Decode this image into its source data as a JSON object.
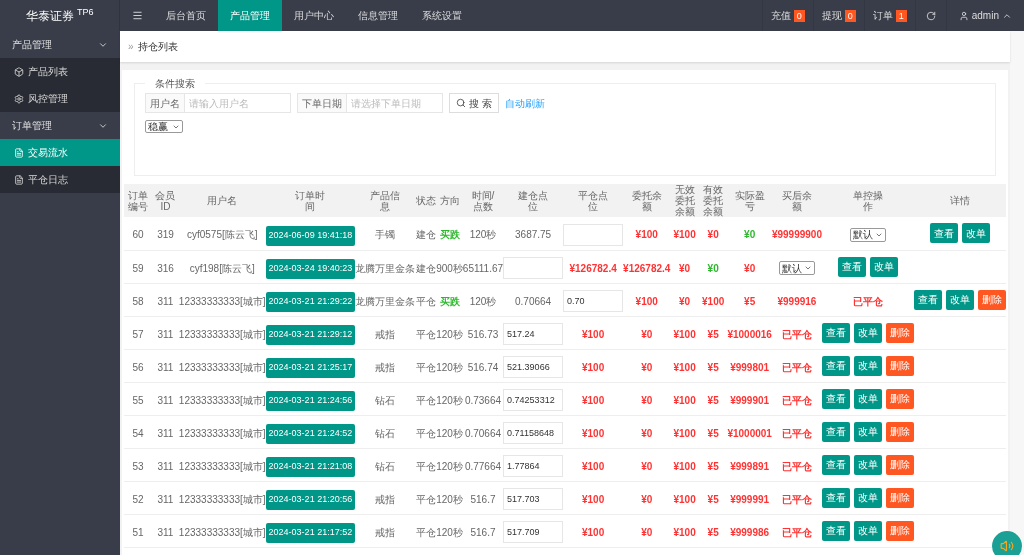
{
  "logo": {
    "text": "华泰证券 $^{TP6}$"
  },
  "top_nav": {
    "tabs": [
      {
        "label": "后台首页",
        "selected": false
      },
      {
        "label": "产品管理",
        "selected": true
      },
      {
        "label": "用户中心",
        "selected": false
      },
      {
        "label": "信息管理",
        "selected": false
      },
      {
        "label": "系统设置",
        "selected": false
      }
    ],
    "counters": [
      {
        "label": "充值",
        "count": "0"
      },
      {
        "label": "提现",
        "count": "0"
      },
      {
        "label": "订单",
        "count": "1"
      }
    ],
    "user": "admin"
  },
  "sidebar": {
    "groups": [
      {
        "label": "产品管理",
        "expanded": true,
        "items": [
          {
            "label": "产品列表",
            "kind": "cube",
            "selected": false
          },
          {
            "label": "风控管理",
            "kind": "gear",
            "selected": false
          }
        ]
      },
      {
        "label": "订单管理",
        "expanded": true,
        "items": [
          {
            "label": "交易流水",
            "kind": "doc",
            "selected": true
          },
          {
            "label": "平仓日志",
            "kind": "doc",
            "selected": false
          }
        ]
      }
    ]
  },
  "breadcrumb": {
    "separator": "»",
    "title": "持仓列表"
  },
  "search": {
    "legend": "条件搜索",
    "fields": [
      {
        "label": "用户名",
        "placeholder": "请输入用户名"
      },
      {
        "label": "下单日期",
        "placeholder": "请选择下单日期"
      }
    ],
    "button": "搜 索",
    "link": "自动刷新",
    "select": "稳赢"
  },
  "table": {
    "columns": [
      "订单编号",
      "会员ID",
      "用户名",
      "订单时间",
      "产品信息",
      "状态",
      "方向",
      "时间/点数",
      "建仓点位",
      "平仓点位",
      "委托余额",
      "无效委托余额",
      "有效委托余额",
      "实际盈亏",
      "买后余额",
      "单控操作",
      "详情"
    ],
    "rows": [
      {
        "cells": [
          {
            "kind": "text",
            "text": "60"
          },
          {
            "kind": "text",
            "text": "319"
          },
          {
            "kind": "text",
            "text": "cyf0575[陈云飞]"
          },
          {
            "kind": "date",
            "text": "2024-06-09 19:41:18"
          },
          {
            "kind": "text",
            "text": "手镯"
          },
          {
            "kind": "text",
            "text": "建仓"
          },
          {
            "kind": "text",
            "text": "买跌",
            "color": "#2eb82e"
          },
          {
            "kind": "text",
            "text": "120秒"
          },
          {
            "kind": "text",
            "text": "3687.75"
          },
          {
            "kind": "input"
          },
          {
            "kind": "text",
            "text": "¥100",
            "color": "#ff3333"
          },
          {
            "kind": "text",
            "text": "¥100",
            "color": "#ff3333"
          },
          {
            "kind": "text",
            "text": "¥0",
            "color": "#ff3333"
          },
          {
            "kind": "text",
            "text": "¥0",
            "color": "#2eb82e"
          },
          {
            "kind": "text",
            "text": "¥99999900",
            "color": "#ff3333"
          },
          {
            "kind": "select",
            "value": "默认"
          },
          {
            "kind": "buttons",
            "buttons": [
              {
                "label": "查看",
                "kind": "primary"
              },
              {
                "label": "改单",
                "kind": "primary"
              }
            ]
          }
        ]
      },
      {
        "cells": [
          {
            "kind": "text",
            "text": "59"
          },
          {
            "kind": "text",
            "text": "316"
          },
          {
            "kind": "text",
            "text": "cyf198[陈云飞]"
          },
          {
            "kind": "date",
            "text": "2024-03-24 19:40:23"
          },
          {
            "kind": "text",
            "text": "龙腾万里金条"
          },
          {
            "kind": "text",
            "text": "建仓"
          },
          {
            "kind": "text",
            "text": "900秒"
          },
          {
            "kind": "text",
            "text": "65111.67"
          },
          {
            "kind": "input"
          },
          {
            "kind": "text",
            "text": "¥126782.4",
            "color": "#ff3333"
          },
          {
            "kind": "text",
            "text": "¥126782.4",
            "color": "#ff3333"
          },
          {
            "kind": "text",
            "text": "¥0",
            "color": "#ff3333"
          },
          {
            "kind": "text",
            "text": "¥0",
            "color": "#2eb82e"
          },
          {
            "kind": "text",
            "text": "¥0",
            "color": "#ff3333"
          },
          {
            "kind": "select",
            "value": "默认"
          },
          {
            "kind": "buttons",
            "buttons": [
              {
                "label": "查看",
                "kind": "primary"
              },
              {
                "label": "改单",
                "kind": "primary"
              }
            ]
          }
        ]
      },
      {
        "cells": [
          {
            "kind": "text",
            "text": "58"
          },
          {
            "kind": "text",
            "text": "311"
          },
          {
            "kind": "text",
            "text": "12333333333[城市]"
          },
          {
            "kind": "date",
            "text": "2024-03-21 21:29:22"
          },
          {
            "kind": "text",
            "text": "龙腾万里金条"
          },
          {
            "kind": "text",
            "text": "平仓"
          },
          {
            "kind": "text",
            "text": "买跌",
            "color": "#2eb82e"
          },
          {
            "kind": "text",
            "text": "120秒"
          },
          {
            "kind": "text",
            "text": "0.70664"
          },
          {
            "kind": "input",
            "value": "0.70"
          },
          {
            "kind": "text",
            "text": "¥100",
            "color": "#ff3333"
          },
          {
            "kind": "text",
            "text": "¥0",
            "color": "#ff3333"
          },
          {
            "kind": "text",
            "text": "¥100",
            "color": "#ff3333"
          },
          {
            "kind": "text",
            "text": "¥5",
            "color": "#ff3333"
          },
          {
            "kind": "text",
            "text": "¥999916",
            "color": "#ff3333"
          },
          {
            "kind": "text",
            "text": "已平仓",
            "color": "#ff3333"
          },
          {
            "kind": "buttons",
            "buttons": [
              {
                "label": "查看",
                "kind": "primary"
              },
              {
                "label": "改单",
                "kind": "primary"
              },
              {
                "label": "删除",
                "kind": "danger"
              }
            ]
          }
        ]
      },
      {
        "cells": [
          {
            "kind": "text",
            "text": "57"
          },
          {
            "kind": "text",
            "text": "311"
          },
          {
            "kind": "text",
            "text": "12333333333[城市]"
          },
          {
            "kind": "date",
            "text": "2024-03-21 21:29:12"
          },
          {
            "kind": "text",
            "text": "戒指"
          },
          {
            "kind": "text",
            "text": "平仓"
          },
          {
            "kind": "text",
            "text": "120秒"
          },
          {
            "kind": "text",
            "text": "516.73"
          },
          {
            "kind": "input",
            "value": "517.24"
          },
          {
            "kind": "text",
            "text": "¥100",
            "color": "#ff3333"
          },
          {
            "kind": "text",
            "text": "¥0",
            "color": "#ff3333"
          },
          {
            "kind": "text",
            "text": "¥100",
            "color": "#ff3333"
          },
          {
            "kind": "text",
            "text": "¥5",
            "color": "#ff3333"
          },
          {
            "kind": "text",
            "text": "¥1000016",
            "color": "#ff3333"
          },
          {
            "kind": "text",
            "text": "已平仓",
            "color": "#ff3333"
          },
          {
            "kind": "buttons",
            "buttons": [
              {
                "label": "查看",
                "kind": "primary"
              },
              {
                "label": "改单",
                "kind": "primary"
              },
              {
                "label": "删除",
                "kind": "danger"
              }
            ]
          }
        ]
      },
      {
        "cells": [
          {
            "kind": "text",
            "text": "56"
          },
          {
            "kind": "text",
            "text": "311"
          },
          {
            "kind": "text",
            "text": "12333333333[城市]"
          },
          {
            "kind": "date",
            "text": "2024-03-21 21:25:17"
          },
          {
            "kind": "text",
            "text": "戒指"
          },
          {
            "kind": "text",
            "text": "平仓"
          },
          {
            "kind": "text",
            "text": "120秒"
          },
          {
            "kind": "text",
            "text": "516.74"
          },
          {
            "kind": "input",
            "value": "521.39066"
          },
          {
            "kind": "text",
            "text": "¥100",
            "color": "#ff3333"
          },
          {
            "kind": "text",
            "text": "¥0",
            "color": "#ff3333"
          },
          {
            "kind": "text",
            "text": "¥100",
            "color": "#ff3333"
          },
          {
            "kind": "text",
            "text": "¥5",
            "color": "#ff3333"
          },
          {
            "kind": "text",
            "text": "¥999801",
            "color": "#ff3333"
          },
          {
            "kind": "text",
            "text": "已平仓",
            "color": "#ff3333"
          },
          {
            "kind": "buttons",
            "buttons": [
              {
                "label": "查看",
                "kind": "primary"
              },
              {
                "label": "改单",
                "kind": "primary"
              },
              {
                "label": "删除",
                "kind": "danger"
              }
            ]
          }
        ]
      },
      {
        "cells": [
          {
            "kind": "text",
            "text": "55"
          },
          {
            "kind": "text",
            "text": "311"
          },
          {
            "kind": "text",
            "text": "12333333333[城市]"
          },
          {
            "kind": "date",
            "text": "2024-03-21 21:24:56"
          },
          {
            "kind": "text",
            "text": "钻石"
          },
          {
            "kind": "text",
            "text": "平仓"
          },
          {
            "kind": "text",
            "text": "120秒"
          },
          {
            "kind": "text",
            "text": "0.73664"
          },
          {
            "kind": "input",
            "value": "0.74253312"
          },
          {
            "kind": "text",
            "text": "¥100",
            "color": "#ff3333"
          },
          {
            "kind": "text",
            "text": "¥0",
            "color": "#ff3333"
          },
          {
            "kind": "text",
            "text": "¥100",
            "color": "#ff3333"
          },
          {
            "kind": "text",
            "text": "¥5",
            "color": "#ff3333"
          },
          {
            "kind": "text",
            "text": "¥999901",
            "color": "#ff3333"
          },
          {
            "kind": "text",
            "text": "已平仓",
            "color": "#ff3333"
          },
          {
            "kind": "buttons",
            "buttons": [
              {
                "label": "查看",
                "kind": "primary"
              },
              {
                "label": "改单",
                "kind": "primary"
              },
              {
                "label": "删除",
                "kind": "danger"
              }
            ]
          }
        ]
      },
      {
        "cells": [
          {
            "kind": "text",
            "text": "54"
          },
          {
            "kind": "text",
            "text": "311"
          },
          {
            "kind": "text",
            "text": "12333333333[城市]"
          },
          {
            "kind": "date",
            "text": "2024-03-21 21:24:52"
          },
          {
            "kind": "text",
            "text": "钻石"
          },
          {
            "kind": "text",
            "text": "平仓"
          },
          {
            "kind": "text",
            "text": "120秒"
          },
          {
            "kind": "text",
            "text": "0.70664"
          },
          {
            "kind": "input",
            "value": "0.71158648"
          },
          {
            "kind": "text",
            "text": "¥100",
            "color": "#ff3333"
          },
          {
            "kind": "text",
            "text": "¥0",
            "color": "#ff3333"
          },
          {
            "kind": "text",
            "text": "¥100",
            "color": "#ff3333"
          },
          {
            "kind": "text",
            "text": "¥5",
            "color": "#ff3333"
          },
          {
            "kind": "text",
            "text": "¥1000001",
            "color": "#ff3333"
          },
          {
            "kind": "text",
            "text": "已平仓",
            "color": "#ff3333"
          },
          {
            "kind": "buttons",
            "buttons": [
              {
                "label": "查看",
                "kind": "primary"
              },
              {
                "label": "改单",
                "kind": "primary"
              },
              {
                "label": "删除",
                "kind": "danger"
              }
            ]
          }
        ]
      },
      {
        "cells": [
          {
            "kind": "text",
            "text": "53"
          },
          {
            "kind": "text",
            "text": "311"
          },
          {
            "kind": "text",
            "text": "12333333333[城市]"
          },
          {
            "kind": "date",
            "text": "2024-03-21 21:21:08"
          },
          {
            "kind": "text",
            "text": "钻石"
          },
          {
            "kind": "text",
            "text": "平仓"
          },
          {
            "kind": "text",
            "text": "120秒"
          },
          {
            "kind": "text",
            "text": "0.77664"
          },
          {
            "kind": "input",
            "value": "1.77864"
          },
          {
            "kind": "text",
            "text": "¥100",
            "color": "#ff3333"
          },
          {
            "kind": "text",
            "text": "¥0",
            "color": "#ff3333"
          },
          {
            "kind": "text",
            "text": "¥100",
            "color": "#ff3333"
          },
          {
            "kind": "text",
            "text": "¥5",
            "color": "#ff3333"
          },
          {
            "kind": "text",
            "text": "¥999891",
            "color": "#ff3333"
          },
          {
            "kind": "text",
            "text": "已平仓",
            "color": "#ff3333"
          },
          {
            "kind": "buttons",
            "buttons": [
              {
                "label": "查看",
                "kind": "primary"
              },
              {
                "label": "改单",
                "kind": "primary"
              },
              {
                "label": "删除",
                "kind": "danger"
              }
            ]
          }
        ]
      },
      {
        "cells": [
          {
            "kind": "text",
            "text": "52"
          },
          {
            "kind": "text",
            "text": "311"
          },
          {
            "kind": "text",
            "text": "12333333333[城市]"
          },
          {
            "kind": "date",
            "text": "2024-03-21 21:20:56"
          },
          {
            "kind": "text",
            "text": "戒指"
          },
          {
            "kind": "text",
            "text": "平仓"
          },
          {
            "kind": "text",
            "text": "120秒"
          },
          {
            "kind": "text",
            "text": "516.7"
          },
          {
            "kind": "input",
            "value": "517.703"
          },
          {
            "kind": "text",
            "text": "¥100",
            "color": "#ff3333"
          },
          {
            "kind": "text",
            "text": "¥0",
            "color": "#ff3333"
          },
          {
            "kind": "text",
            "text": "¥100",
            "color": "#ff3333"
          },
          {
            "kind": "text",
            "text": "¥5",
            "color": "#ff3333"
          },
          {
            "kind": "text",
            "text": "¥999991",
            "color": "#ff3333"
          },
          {
            "kind": "text",
            "text": "已平仓",
            "color": "#ff3333"
          },
          {
            "kind": "buttons",
            "buttons": [
              {
                "label": "查看",
                "kind": "primary"
              },
              {
                "label": "改单",
                "kind": "primary"
              },
              {
                "label": "删除",
                "kind": "danger"
              }
            ]
          }
        ]
      },
      {
        "cells": [
          {
            "kind": "text",
            "text": "51"
          },
          {
            "kind": "text",
            "text": "311"
          },
          {
            "kind": "text",
            "text": "12333333333[城市]"
          },
          {
            "kind": "date",
            "text": "2024-03-21 21:17:52"
          },
          {
            "kind": "text",
            "text": "戒指"
          },
          {
            "kind": "text",
            "text": "平仓"
          },
          {
            "kind": "text",
            "text": "120秒"
          },
          {
            "kind": "text",
            "text": "516.7"
          },
          {
            "kind": "input",
            "value": "517.709"
          },
          {
            "kind": "text",
            "text": "¥100",
            "color": "#ff3333"
          },
          {
            "kind": "text",
            "text": "¥0",
            "color": "#ff3333"
          },
          {
            "kind": "text",
            "text": "¥100",
            "color": "#ff3333"
          },
          {
            "kind": "text",
            "text": "¥5",
            "color": "#ff3333"
          },
          {
            "kind": "text",
            "text": "¥999986",
            "color": "#ff3333"
          },
          {
            "kind": "text",
            "text": "已平仓",
            "color": "#ff3333"
          },
          {
            "kind": "buttons",
            "buttons": [
              {
                "label": "查看",
                "kind": "primary"
              },
              {
                "label": "改单",
                "kind": "primary"
              },
              {
                "label": "删除",
                "kind": "danger"
              }
            ]
          }
        ]
      }
    ]
  }
}
